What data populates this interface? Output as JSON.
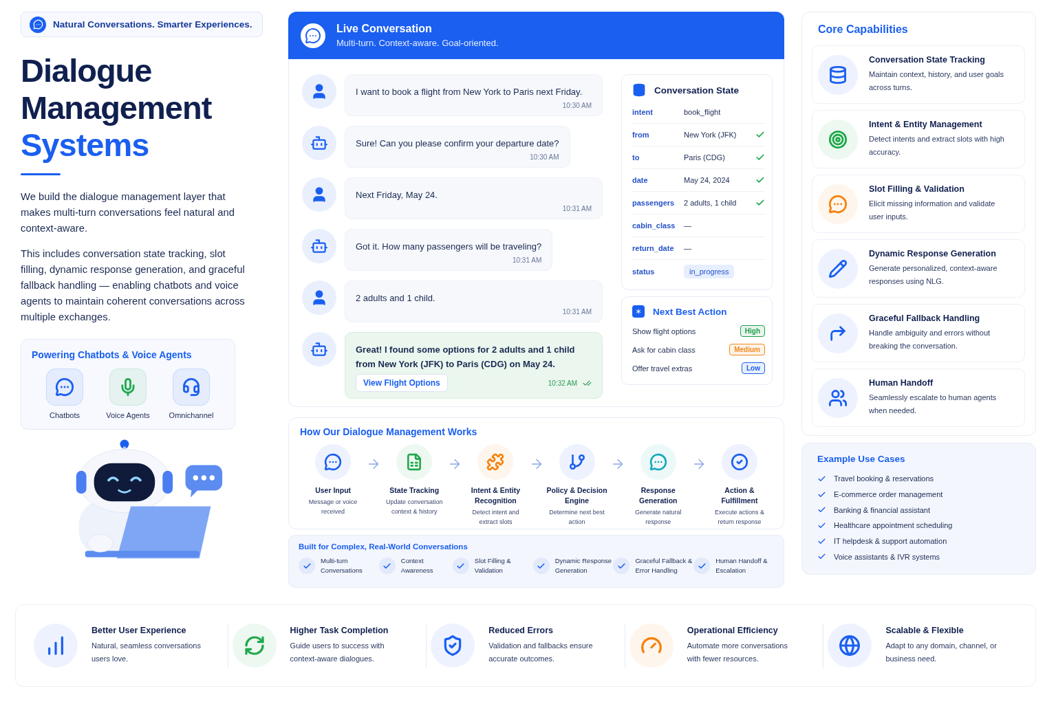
{
  "tagline": "Natural Conversations. Smarter Experiences.",
  "title_lines": [
    {
      "text": "Dialogue",
      "highlighted": false
    },
    {
      "text": "Management",
      "highlighted": false
    },
    {
      "text": "Systems",
      "highlighted": true
    }
  ],
  "paragraphs": [
    "We build the dialogue management layer that makes multi-turn conversations feel natural and context-aware.",
    "This includes conversation state tracking, slot filling, dynamic response generation, and graceful fallback handling — enabling chatbots and voice agents to maintain coherent conversations across multiple exchanges."
  ],
  "powering": {
    "title": "Powering Chatbots & Voice Agents",
    "channels": [
      {
        "label": "Chatbots",
        "color": "#1a5ff0"
      },
      {
        "label": "Voice Agents",
        "color": "#1fa84a"
      },
      {
        "label": "Omnichannel",
        "color": "#1a5ff0"
      }
    ]
  },
  "conversation": {
    "title": "Live Conversation",
    "subtitle": "Multi-turn. Context-aware. Goal-oriented.",
    "messages": [
      {
        "kind": "user",
        "text": "I want to book a flight from New York to Paris next Friday.",
        "time": "10:30 AM",
        "highlighted": false,
        "read": false
      },
      {
        "kind": "bot",
        "text": "Sure! Can you please confirm your departure date?",
        "time": "10:30 AM",
        "highlighted": false,
        "read": false
      },
      {
        "kind": "user",
        "text": "Next Friday, May 24.",
        "time": "10:31 AM",
        "highlighted": false,
        "read": false
      },
      {
        "kind": "bot",
        "text": "Got it. How many passengers will be traveling?",
        "time": "10:31 AM",
        "highlighted": false,
        "read": false
      },
      {
        "kind": "user",
        "text": "2 adults and 1 child.",
        "time": "10:31 AM",
        "highlighted": false,
        "read": false
      },
      {
        "kind": "bot",
        "text": "Great! I found some options for 2 adults and 1 child from New York (JFK) to Paris (CDG) on May 24.",
        "time": "10:32 AM",
        "highlighted": true,
        "read": true,
        "action": "View Flight Options"
      }
    ]
  },
  "state": {
    "title": "Conversation State",
    "rows": [
      {
        "kind": "text",
        "key": "intent",
        "value": "book_flight",
        "confirmed": false
      },
      {
        "kind": "text",
        "key": "from",
        "value": "New York (JFK)",
        "confirmed": true
      },
      {
        "kind": "text",
        "key": "to",
        "value": "Paris (CDG)",
        "confirmed": true
      },
      {
        "kind": "text",
        "key": "date",
        "value": "May 24, 2024",
        "confirmed": true
      },
      {
        "kind": "text",
        "key": "passengers",
        "value": "2 adults, 1 child",
        "confirmed": true
      },
      {
        "kind": "text",
        "key": "cabin_class",
        "value": "—",
        "confirmed": false
      },
      {
        "kind": "text",
        "key": "return_date",
        "value": "—",
        "confirmed": false
      },
      {
        "kind": "pill",
        "key": "status",
        "value": "in_progress",
        "confirmed": false
      }
    ]
  },
  "next_best_action": {
    "title": "Next Best Action",
    "items": [
      {
        "label": "Show flight options",
        "priority": "High",
        "color": "#1f9d4c"
      },
      {
        "label": "Ask for cabin class",
        "priority": "Medium",
        "color": "#f08a1c"
      },
      {
        "label": "Offer travel extras",
        "priority": "Low",
        "color": "#1a5ff0"
      }
    ]
  },
  "process": {
    "title": "How Our Dialogue Management Works",
    "steps": [
      {
        "title": "User Input",
        "description": "Message or voice received",
        "color": "#1a5ff0"
      },
      {
        "title": "State Tracking",
        "description": "Update conversation context & history",
        "color": "#1fa84a"
      },
      {
        "title": "Intent & Entity Recognition",
        "description": "Detect intent and extract slots",
        "color": "#f5820d"
      },
      {
        "title": "Policy & Decision Engine",
        "description": "Determine next best action",
        "color": "#1a5ff0"
      },
      {
        "title": "Response Generation",
        "description": "Generate natural response",
        "color": "#14a8b8"
      },
      {
        "title": "Action & Fulfillment",
        "description": "Execute actions & return response",
        "color": "#1a5ff0"
      }
    ]
  },
  "features": {
    "title": "Built for Complex, Real-World Conversations",
    "items": [
      "Multi-turn Conversations",
      "Context Awareness",
      "Slot Filling & Validation",
      "Dynamic Response Generation",
      "Graceful Fallback & Error Handling",
      "Human Handoff & Escalation"
    ]
  },
  "capabilities": {
    "title": "Core Capabilities",
    "items": [
      {
        "title": "Conversation State Tracking",
        "description": "Maintain context, history, and user goals across turns.",
        "color": "#1a5ff0"
      },
      {
        "title": "Intent & Entity Management",
        "description": "Detect intents and extract slots with high accuracy.",
        "color": "#1fa84a"
      },
      {
        "title": "Slot Filling & Validation",
        "description": "Elicit missing information and validate user inputs.",
        "color": "#f5820d"
      },
      {
        "title": "Dynamic Response Generation",
        "description": "Generate personalized, context-aware responses using NLG.",
        "color": "#1a5ff0"
      },
      {
        "title": "Graceful Fallback Handling",
        "description": "Handle ambiguity and errors without breaking the conversation.",
        "color": "#1a5ff0"
      },
      {
        "title": "Human Handoff",
        "description": "Seamlessly escalate to human agents when needed.",
        "color": "#1a5ff0"
      }
    ]
  },
  "use_cases": {
    "title": "Example Use Cases",
    "items": [
      "Travel booking & reservations",
      "E-commerce order management",
      "Banking & financial assistant",
      "Healthcare appointment scheduling",
      "IT helpdesk & support automation",
      "Voice assistants & IVR systems"
    ]
  },
  "benefits": [
    {
      "title": "Better User Experience",
      "description": "Natural, seamless conversations users love.",
      "color": "#1a5ff0"
    },
    {
      "title": "Higher Task Completion",
      "description": "Guide users to success with context-aware dialogues.",
      "color": "#1fa84a"
    },
    {
      "title": "Reduced Errors",
      "description": "Validation and fallbacks ensure accurate outcomes.",
      "color": "#1a5ff0"
    },
    {
      "title": "Operational Efficiency",
      "description": "Automate more conversations with fewer resources.",
      "color": "#f5820d"
    },
    {
      "title": "Scalable & Flexible",
      "description": "Adapt to any domain, channel, or business need.",
      "color": "#1a5ff0"
    }
  ]
}
